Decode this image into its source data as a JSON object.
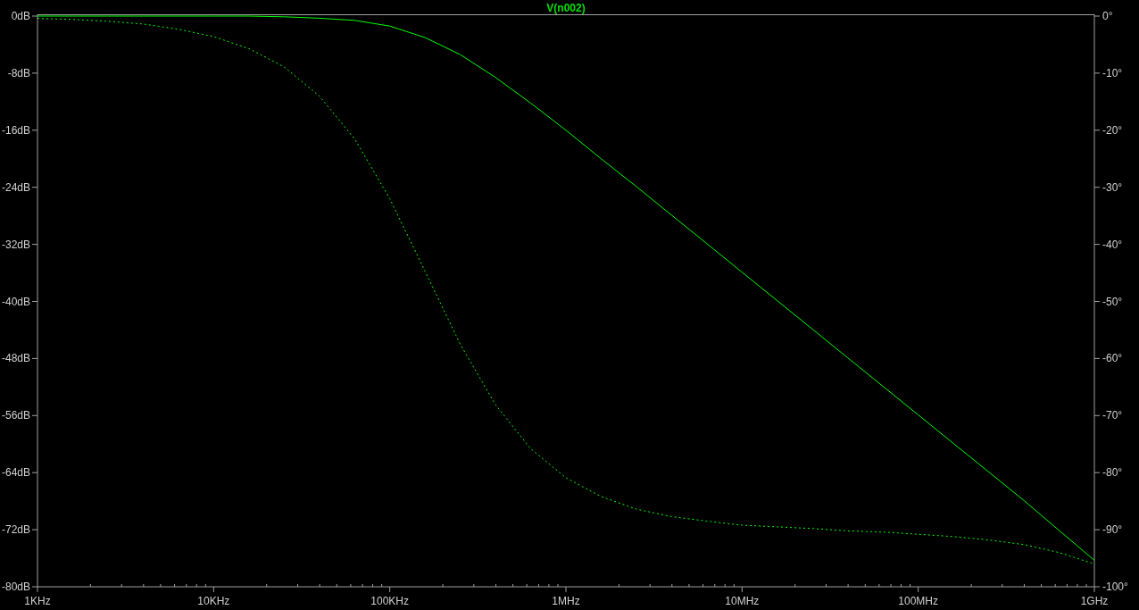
{
  "chart_data": {
    "type": "line",
    "title": "V(n002)",
    "categories": [
      "1KHz",
      null,
      null,
      null,
      null,
      "10KHz",
      null,
      null,
      null,
      null,
      "100KHz",
      null,
      null,
      null,
      null,
      "1MHz",
      null,
      null,
      null,
      null,
      "10MHz",
      null,
      null,
      null,
      null,
      "100MHz",
      null,
      null,
      null,
      null,
      "1GHz"
    ],
    "ylim": [
      -80,
      0
    ],
    "yticks": [
      {
        "value": 0,
        "label": "0dB"
      },
      {
        "value": -8,
        "label": "-8dB"
      },
      {
        "value": -16,
        "label": "-16dB"
      },
      {
        "value": -24,
        "label": "-24dB"
      },
      {
        "value": -32,
        "label": "-32dB"
      },
      {
        "value": -40,
        "label": "-40dB"
      },
      {
        "value": -48,
        "label": "-48dB"
      },
      {
        "value": -56,
        "label": "-56dB"
      },
      {
        "value": -64,
        "label": "-64dB"
      },
      {
        "value": -72,
        "label": "-72dB"
      },
      {
        "value": -80,
        "label": "-80dB"
      }
    ],
    "y2lim": [
      -100,
      0
    ],
    "y2ticks": [
      {
        "value": 0,
        "label": "0°"
      },
      {
        "value": -10,
        "label": "-10°"
      },
      {
        "value": -20,
        "label": "-20°"
      },
      {
        "value": -30,
        "label": "-30°"
      },
      {
        "value": -40,
        "label": "-40°"
      },
      {
        "value": -50,
        "label": "-50°"
      },
      {
        "value": -60,
        "label": "-60°"
      },
      {
        "value": -70,
        "label": "-70°"
      },
      {
        "value": -80,
        "label": "-80°"
      },
      {
        "value": -90,
        "label": "-90°"
      },
      {
        "value": -100,
        "label": "-100°"
      }
    ],
    "series": [
      {
        "color": "#00ff00",
        "values": [
          0,
          0,
          0,
          0,
          0,
          0,
          0,
          -0.1,
          -0.3,
          -0.6,
          -1.4,
          -3,
          -5.4,
          -8.6,
          -12.2,
          -16,
          -20,
          -23.9,
          -27.9,
          -31.9,
          -35.9,
          -39.9,
          -43.9,
          -47.9,
          -51.9,
          -55.9,
          -59.9,
          -63.9,
          -67.9,
          -72.1,
          -76.3
        ]
      },
      {
        "color": "#00ff00",
        "axis": "y2",
        "line_style": "dashed",
        "values": [
          -0.4,
          -0.6,
          -0.9,
          -1.4,
          -2.3,
          -3.6,
          -5.7,
          -8.9,
          -14,
          -21.5,
          -32,
          -44.7,
          -57.5,
          -68.1,
          -75.8,
          -80.9,
          -84.2,
          -86.4,
          -87.7,
          -88.5,
          -89.2,
          -89.5,
          -89.8,
          -90.2,
          -90.4,
          -90.8,
          -91.2,
          -91.8,
          -92.6,
          -94,
          -96
        ]
      }
    ]
  }
}
